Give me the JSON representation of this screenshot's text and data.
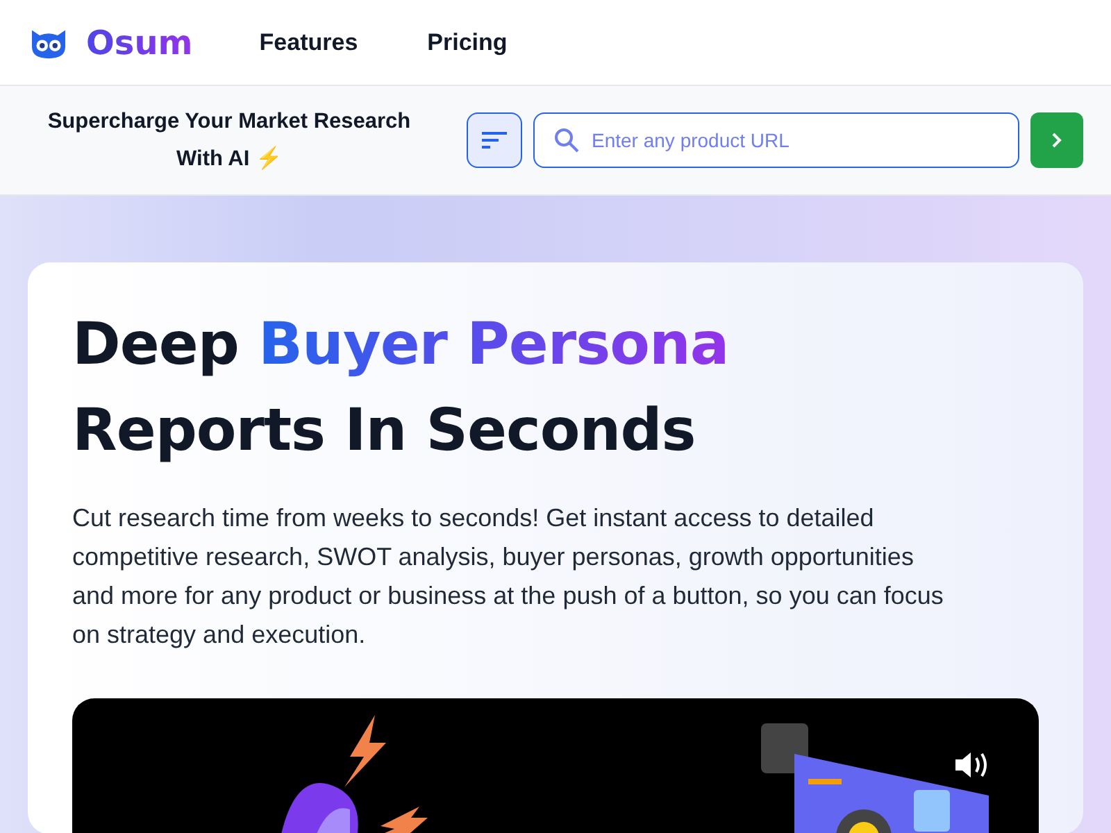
{
  "header": {
    "brand": "Osum",
    "nav": [
      {
        "label": "Features"
      },
      {
        "label": "Pricing"
      }
    ]
  },
  "search_bar": {
    "tagline": "Supercharge Your Market Research With AI ⚡",
    "placeholder": "Enter any product URL"
  },
  "hero": {
    "heading": [
      {
        "text": "Deep ",
        "highlight": false
      },
      {
        "text": "Buyer Persona",
        "highlight": true
      },
      {
        "text": " Reports In Seconds",
        "highlight": false
      }
    ],
    "description": "Cut research time from weeks to seconds! Get instant access to detailed competitive research, SWOT analysis, buyer personas, growth opportunities and more for any product or business at the push of a button, so you can focus on strategy and execution.",
    "video": {
      "muted": false
    }
  }
}
